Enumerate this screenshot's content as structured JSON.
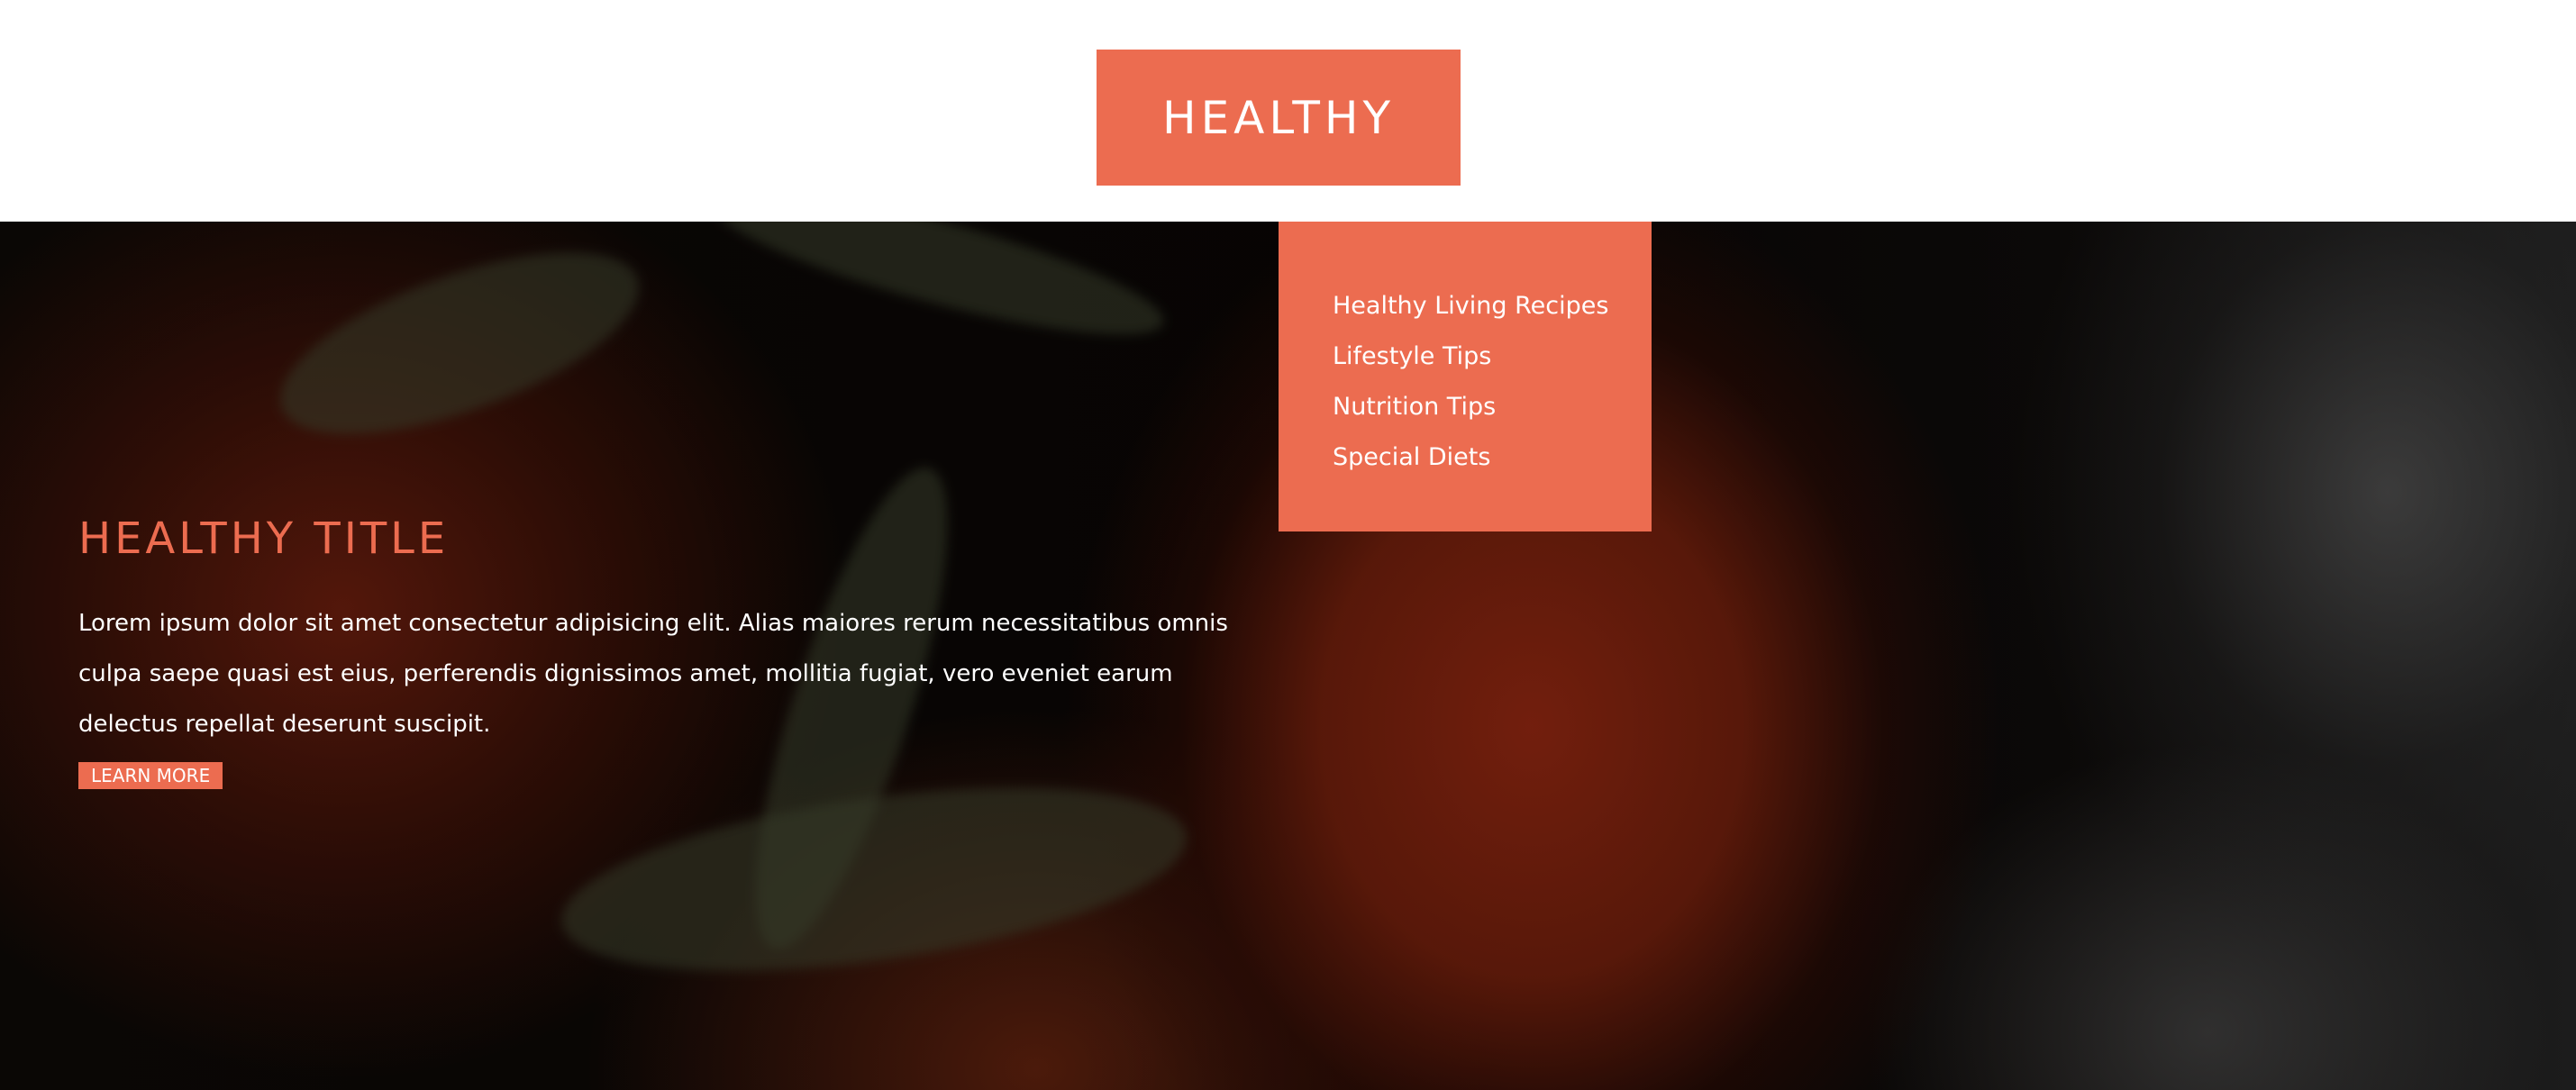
{
  "header": {
    "logo_text": "HEALTHY"
  },
  "nav": {
    "dropdown_items": [
      {
        "label": "Healthy Living Recipes"
      },
      {
        "label": "Lifestyle Tips"
      },
      {
        "label": "Nutrition Tips"
      },
      {
        "label": "Special Diets"
      }
    ]
  },
  "hero": {
    "title": "HEALTHY TITLE",
    "text": "Lorem ipsum dolor sit amet consectetur adipisicing elit. Alias maiores rerum necessitatibus omnis culpa saepe quasi est eius, perferendis dignissimos amet, mollitia fugiat, vero eveniet earum delectus repellat deserunt suscipit.",
    "button_label": "LEARN MORE"
  },
  "colors": {
    "accent": "#ec6c50",
    "header_bg": "#ffffff",
    "text_light": "#ffffff"
  }
}
